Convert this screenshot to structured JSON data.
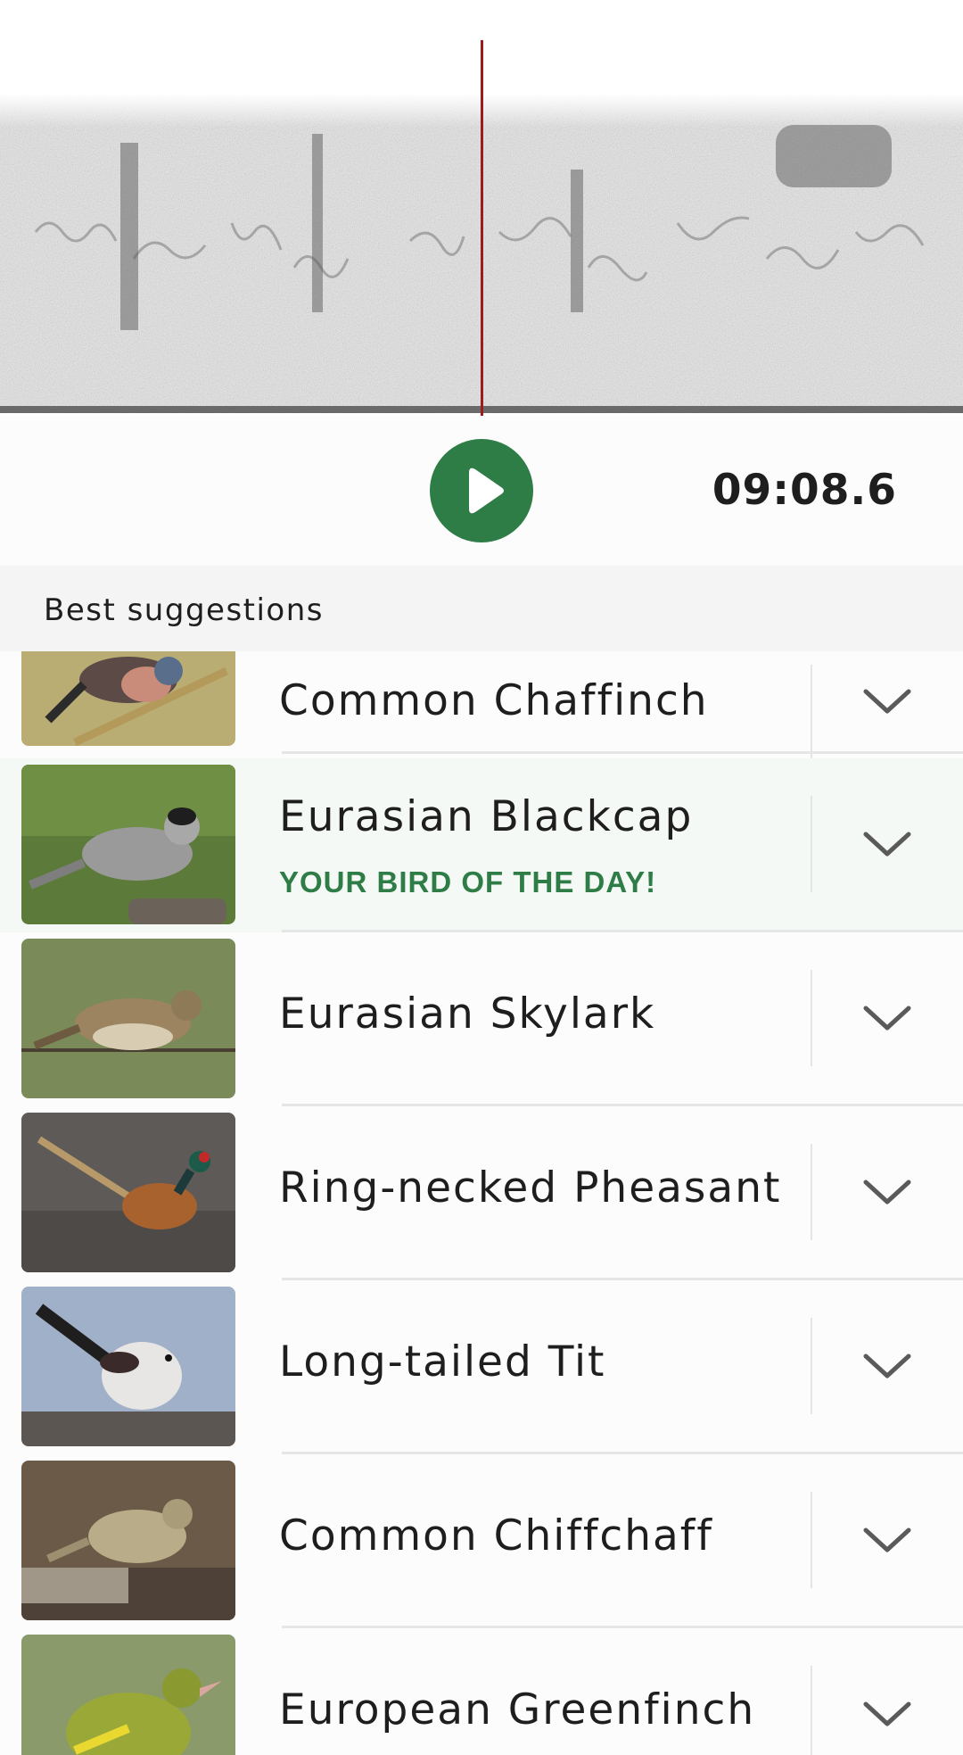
{
  "player": {
    "time": "09:08.6",
    "play_icon": "play-icon",
    "accent": "#2e7d46",
    "cursor_color": "#9b1c1c"
  },
  "suggestions": {
    "header": "Best suggestions",
    "items": [
      {
        "name": "Common Chaffinch",
        "tag": ""
      },
      {
        "name": "Eurasian Blackcap",
        "tag": "YOUR BIRD OF THE DAY!"
      },
      {
        "name": "Eurasian Skylark",
        "tag": ""
      },
      {
        "name": "Ring-necked Pheasant",
        "tag": ""
      },
      {
        "name": "Long-tailed Tit",
        "tag": ""
      },
      {
        "name": "Common Chiffchaff",
        "tag": ""
      },
      {
        "name": "European Greenfinch",
        "tag": ""
      }
    ]
  }
}
